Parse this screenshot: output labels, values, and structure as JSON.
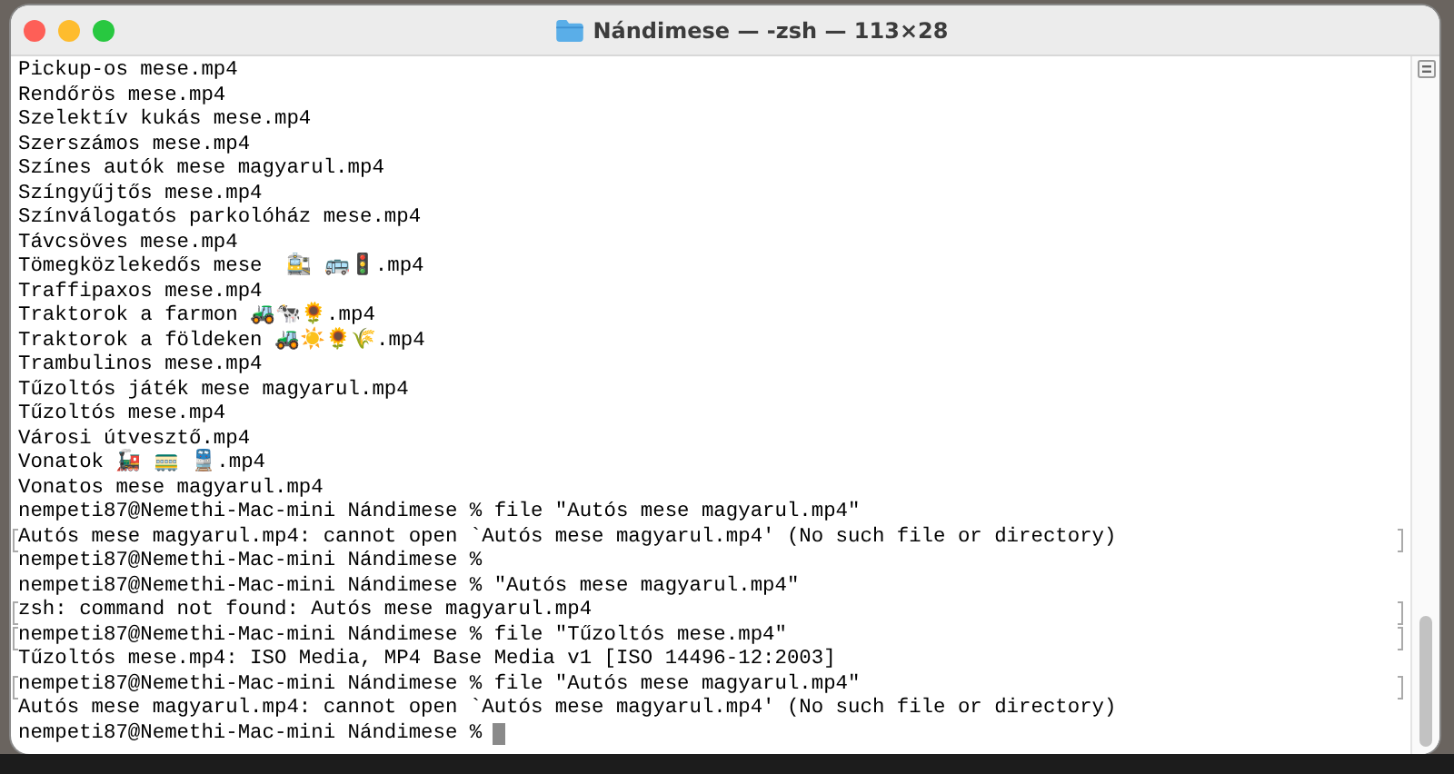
{
  "window": {
    "title": "Nándimese — -zsh — 113×28"
  },
  "terminal": {
    "cursor": true,
    "lines": [
      {
        "text": "Pickup-os mese.mp4",
        "marked": false
      },
      {
        "text": "Rendőrös mese.mp4",
        "marked": false
      },
      {
        "text": "Szelektív kukás mese.mp4",
        "marked": false
      },
      {
        "text": "Szerszámos mese.mp4",
        "marked": false
      },
      {
        "text": "Színes autók mese magyarul.mp4",
        "marked": false
      },
      {
        "text": "Színgyűjtős mese.mp4",
        "marked": false
      },
      {
        "text": "Színválogatós parkolóház mese.mp4",
        "marked": false
      },
      {
        "text": "Távcsöves mese.mp4",
        "marked": false
      },
      {
        "text": "Tömegközlekedős mese  🚉 🚌🚦.mp4",
        "marked": false
      },
      {
        "text": "Traffipaxos mese.mp4",
        "marked": false
      },
      {
        "text": "Traktorok a farmon 🚜🐄🌻.mp4",
        "marked": false
      },
      {
        "text": "Traktorok a földeken 🚜☀️🌻🌾.mp4",
        "marked": false
      },
      {
        "text": "Trambulinos mese.mp4",
        "marked": false
      },
      {
        "text": "Tűzoltós játék mese magyarul.mp4",
        "marked": false
      },
      {
        "text": "Tűzoltós mese.mp4",
        "marked": false
      },
      {
        "text": "Városi útvesztő.mp4",
        "marked": false
      },
      {
        "text": "Vonatok 🚂 🚃 🚆.mp4",
        "marked": false
      },
      {
        "text": "Vonatos mese magyarul.mp4",
        "marked": false
      },
      {
        "text": "nempeti87@Nemethi-Mac-mini Nándimese % file \"Autós mese magyarul.mp4\"",
        "marked": false
      },
      {
        "text": "Autós mese magyarul.mp4: cannot open `Autós mese magyarul.mp4' (No such file or directory)",
        "marked": true
      },
      {
        "text": "nempeti87@Nemethi-Mac-mini Nándimese %",
        "marked": false
      },
      {
        "text": "nempeti87@Nemethi-Mac-mini Nándimese % \"Autós mese magyarul.mp4\"",
        "marked": false
      },
      {
        "text": "zsh: command not found: Autós mese magyarul.mp4",
        "marked": true
      },
      {
        "text": "nempeti87@Nemethi-Mac-mini Nándimese % file \"Tűzoltós mese.mp4\"",
        "marked": true
      },
      {
        "text": "Tűzoltós mese.mp4: ISO Media, MP4 Base Media v1 [ISO 14496-12:2003]",
        "marked": false
      },
      {
        "text": "nempeti87@Nemethi-Mac-mini Nándimese % file \"Autós mese magyarul.mp4\"",
        "marked": true
      },
      {
        "text": "Autós mese magyarul.mp4: cannot open `Autós mese magyarul.mp4' (No such file or directory)",
        "marked": false
      },
      {
        "text": "nempeti87@Nemethi-Mac-mini Nándimese %",
        "marked": false
      }
    ]
  }
}
